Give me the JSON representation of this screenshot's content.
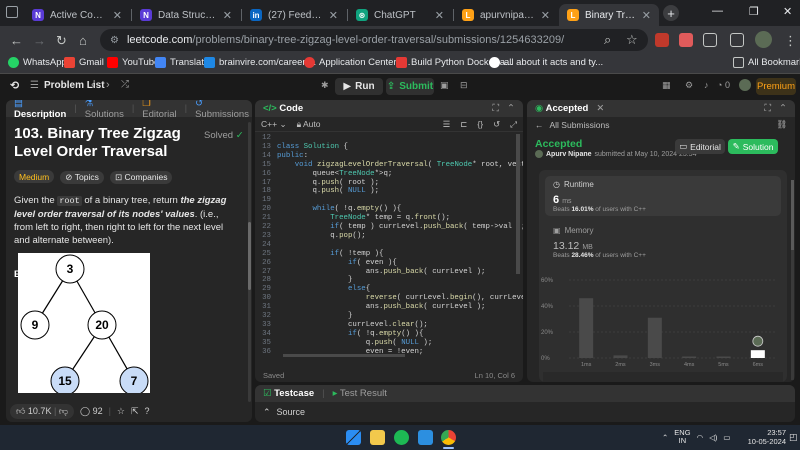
{
  "browser": {
    "tabs": [
      {
        "title": "Active Courses",
        "favicon_color": "#5a3bd6",
        "favicon_text": "N"
      },
      {
        "title": "Data Structures & A",
        "favicon_color": "#5a3bd6",
        "favicon_text": "N"
      },
      {
        "title": "(27) Feed | LinkedIn",
        "favicon_color": "#0a66c2",
        "favicon_text": "in"
      },
      {
        "title": "ChatGPT",
        "favicon_color": "#10a37f",
        "favicon_text": "⊛"
      },
      {
        "title": "apurvnipane111 - Le",
        "favicon_color": "#ffa116",
        "favicon_text": "L"
      },
      {
        "title": "Binary Tree Zigzag L",
        "favicon_color": "#ffa116",
        "favicon_text": "L"
      }
    ],
    "url_host": "leetcode.com",
    "url_path": "/problems/binary-tree-zigzag-level-order-traversal/submissions/1254633209/",
    "bookmarks": [
      "WhatsApp",
      "Gmail",
      "YouTube",
      "Translate",
      "brainvire.com/career/...",
      "Application Center -...",
      "Build Python Docker a...",
      "all about it acts and ty..."
    ],
    "all_bookmarks": "All Bookmarks",
    "colors": {
      "tab_bg": "#202124",
      "bar_bg": "#35363a"
    }
  },
  "leetcode": {
    "problem_list": "Problem List",
    "run": "Run",
    "submit": "Submit",
    "streak": "0",
    "premium": "Premium"
  },
  "description": {
    "tabs": [
      "Description",
      "Solutions",
      "Editorial",
      "Submissions"
    ],
    "title": "103. Binary Tree Zigzag Level Order Traversal",
    "solved": "Solved",
    "chips": [
      "Medium",
      "Topics",
      "Companies"
    ],
    "text_pre": "Given the ",
    "text_code": "root",
    "text_mid": " of a binary tree, return ",
    "text_em": "the zigzag level order traversal of its nodes' values",
    "text_post": ". (i.e., from left to right, then right to left for the next level and alternate between).",
    "example_label": "Example 1:",
    "tree_nodes": [
      "3",
      "9",
      "20",
      "15",
      "7"
    ],
    "likes": "10.7K",
    "comments": "92"
  },
  "code": {
    "tab": "Code",
    "language": "C++",
    "mode": "Auto",
    "start_line": 12,
    "lines": [
      "",
      "class Solution {",
      "public:",
      "    void zigzagLevelOrderTraversal( TreeNode* root, vector<vec",
      "        queue<TreeNode*>q;",
      "        q.push( root );",
      "        q.push( NULL );",
      "",
      "        while( !q.empty() ){",
      "            TreeNode* temp = q.front();",
      "            if( temp ) currLevel.push_back( temp->val );",
      "            q.pop();",
      "",
      "            if( !temp ){",
      "                if( even ){",
      "                    ans.push_back( currLevel );",
      "                }",
      "                else{",
      "                    reverse( currLevel.begin(), currLevel.end() );",
      "                    ans.push_back( currLevel );",
      "                }",
      "                currLevel.clear();",
      "                if( !q.empty() ){",
      "                    q.push( NULL );",
      "                    even = !even;"
    ],
    "status": "Saved",
    "cursor": "Ln 10, Col 6"
  },
  "testcase": {
    "tabs": [
      "Testcase",
      "Test Result"
    ],
    "source": "Source"
  },
  "accepted": {
    "tab": "Accepted",
    "back": "All Submissions",
    "status": "Accepted",
    "user": "Apurv Nipane",
    "submitted": "submitted at May 10, 2024 23:54",
    "editorial": "Editorial",
    "solution": "Solution",
    "runtime_label": "Runtime",
    "runtime_value": "6",
    "runtime_unit": "ms",
    "runtime_beats_pre": "Beats ",
    "runtime_beats": "16.01%",
    "runtime_beats_post": " of users with C++",
    "memory_label": "Memory",
    "memory_value": "13.12",
    "memory_unit": "MB",
    "memory_beats_pre": "Beats ",
    "memory_beats": "28.46%",
    "memory_beats_post": " of users with C++"
  },
  "chart_data": {
    "type": "bar",
    "title": "",
    "xlabel": "",
    "ylabel": "",
    "categories": [
      "1ms",
      "2ms",
      "3ms",
      "4ms",
      "5ms",
      "6ms"
    ],
    "values": [
      46,
      2,
      31,
      1,
      1,
      6
    ],
    "lead_bar_value": 46,
    "yticks": [
      "60%",
      "40%",
      "20%",
      "0%"
    ],
    "ylim": [
      0,
      60
    ],
    "highlight": "6ms",
    "grid": true,
    "colors": {
      "bar": "#4a4a4a",
      "highlight": "#ffffff",
      "grid": "#3d3d3d"
    }
  },
  "taskbar": {
    "lang": "ENG",
    "region": "IN",
    "time": "23:57",
    "date": "10-05-2024"
  }
}
